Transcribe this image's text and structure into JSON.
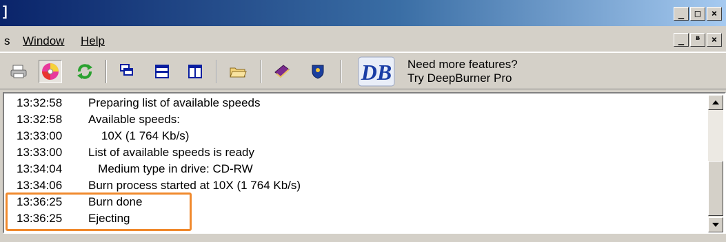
{
  "window": {
    "title_fragment": "]",
    "controls": {
      "minimize": "_",
      "maximize": "□",
      "close": "×"
    }
  },
  "menu": {
    "items": [
      {
        "label": "s"
      },
      {
        "label": "Window"
      },
      {
        "label": "Help"
      }
    ],
    "mdi_controls": {
      "minimize": "_",
      "restore": "ᴯ",
      "close": "×"
    }
  },
  "toolbar": {
    "icons": [
      "printer-icon",
      "disc-icon",
      "refresh-icon",
      "cascade-windows-icon",
      "tile-horizontal-icon",
      "tile-vertical-icon",
      "open-folder-icon",
      "book-icon",
      "shield-icon",
      "deepburner-logo-icon"
    ],
    "logo_text": "DB",
    "promo_line1": "Need more features?",
    "promo_line2": "Try DeepBurner Pro"
  },
  "log": {
    "entries": [
      {
        "time": "13:32:58",
        "message": "Preparing list of available speeds"
      },
      {
        "time": "13:32:58",
        "message": "Available speeds:"
      },
      {
        "time": "13:33:00",
        "message": "    10X (1 764 Kb/s)"
      },
      {
        "time": "13:33:00",
        "message": "List of available speeds is ready"
      },
      {
        "time": "13:34:04",
        "message": "   Medium type in drive: CD-RW"
      },
      {
        "time": "13:34:06",
        "message": "Burn process started at 10X (1 764 Kb/s)"
      },
      {
        "time": "13:36:25",
        "message": "Burn done"
      },
      {
        "time": "13:36:25",
        "message": "Ejecting"
      }
    ]
  },
  "colors": {
    "highlight": "#f0892c",
    "titlebar": "#0a246a",
    "chrome": "#d4d0c8"
  }
}
